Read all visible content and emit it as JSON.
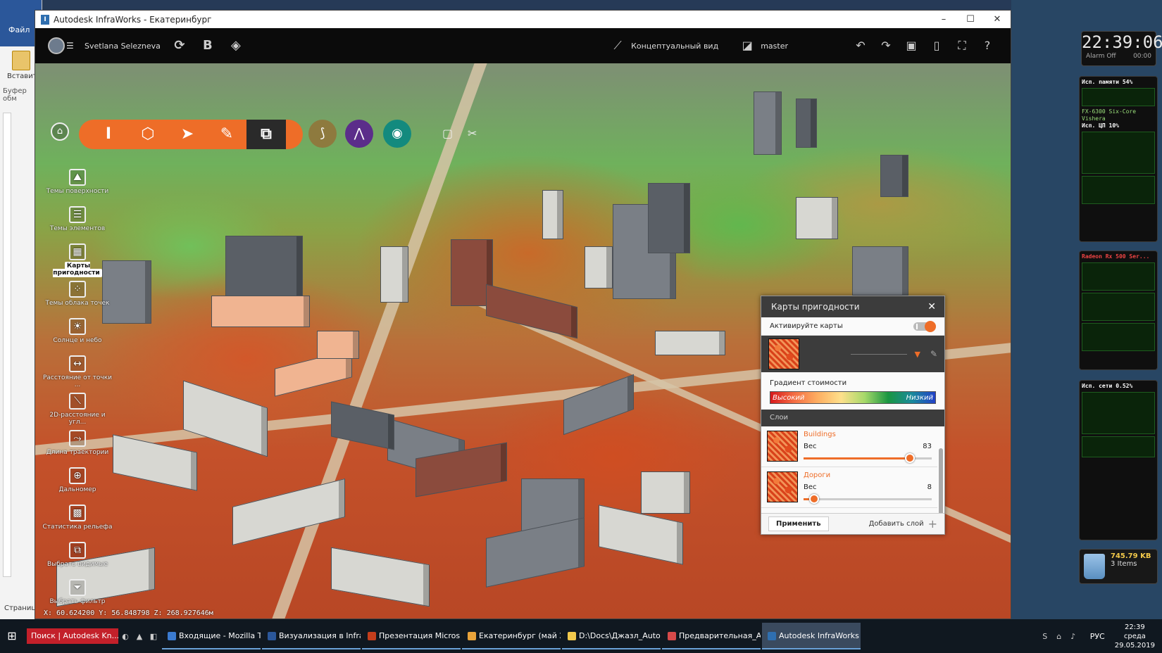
{
  "window": {
    "title": "Autodesk InfraWorks - Екатеринбург",
    "ctrl_min": "–",
    "ctrl_max": "☐",
    "ctrl_close": "✕"
  },
  "word_bg": {
    "tab_file": "Файл",
    "paste": "Вставить",
    "clipboard": "Буфер обм",
    "pages": "Страниц"
  },
  "toolbar": {
    "user": "Svetlana Selezneva",
    "view_mode": "Концептуальный вид",
    "branch": "master"
  },
  "left_tools": [
    {
      "label": "Темы поверхности",
      "glyph": "⛰"
    },
    {
      "label": "Темы элементов",
      "glyph": "☰"
    },
    {
      "label": "Карты пригодности",
      "glyph": "▦"
    },
    {
      "label": "Темы облака точек",
      "glyph": "⁘"
    },
    {
      "label": "Солнце и небо",
      "glyph": "☀"
    },
    {
      "label": "Расстояние от точки ...",
      "glyph": "↔"
    },
    {
      "label": "2D-расстояние и угл...",
      "glyph": "⟍"
    },
    {
      "label": "Длина траектории",
      "glyph": "⤳"
    },
    {
      "label": "Дальномер",
      "glyph": "⊕"
    },
    {
      "label": "Статистика рельефа",
      "glyph": "▩"
    },
    {
      "label": "Выбрать видимые",
      "glyph": "⧉"
    },
    {
      "label": "Выбрать фильтр",
      "glyph": "⏷"
    }
  ],
  "coords": "X: 60.624200 Y: 56.848798 Z: 268.927646м",
  "panel": {
    "title": "Карты пригодности",
    "close": "✕",
    "activate_label": "Активируйте карты",
    "activate_on": true,
    "gradient_title": "Градиент стоимости",
    "gradient_high": "Высокий",
    "gradient_low": "Низкий",
    "layers_title": "Слои",
    "weight_label": "Вес",
    "layers": [
      {
        "name": "Buildings",
        "weight": "83",
        "fraction": 0.83
      },
      {
        "name": "Дороги",
        "weight": "8",
        "fraction": 0.08
      }
    ],
    "apply": "Применить",
    "add_layer": "Добавить слой",
    "accent": "#ee6d28"
  },
  "gadgets": {
    "clock": "22:39:06",
    "alarm": "Alarm Off",
    "alarm_time": "00:00",
    "mem_title": "Исп. памяти",
    "mem_pct": "54%",
    "cpu_name": "FX-6300 Six-Core Vishera",
    "cpu_title": "Исп. ЦП",
    "cpu_pct": "10%",
    "gpu_name": "Radeon Rx 500 Ser...",
    "net_title": "Исп. сети",
    "net_pct": "0.52%",
    "recycle_size": "745.79 KB",
    "recycle_items": "3 Items"
  },
  "taskbar": {
    "search": "Поиск | Autodesk Kn...",
    "items": [
      {
        "label": "Входящие - Mozilla T...",
        "color": "#3b7bd0"
      },
      {
        "label": "Визуализация в Infra...",
        "color": "#2b579a"
      },
      {
        "label": "Презентация Micros...",
        "color": "#c43e1c"
      },
      {
        "label": "Екатеринбург (май 2...",
        "color": "#e8a33b"
      },
      {
        "label": "D:\\Docs\\Джазл_Auto...",
        "color": "#f2c94c"
      },
      {
        "label": "Предварительная_А...",
        "color": "#d64a4a"
      },
      {
        "label": "Autodesk InfraWorks ...",
        "color": "#2f6fb0"
      }
    ],
    "lang": "РУС",
    "time": "22:39",
    "day": "среда",
    "date": "29.05.2019"
  }
}
